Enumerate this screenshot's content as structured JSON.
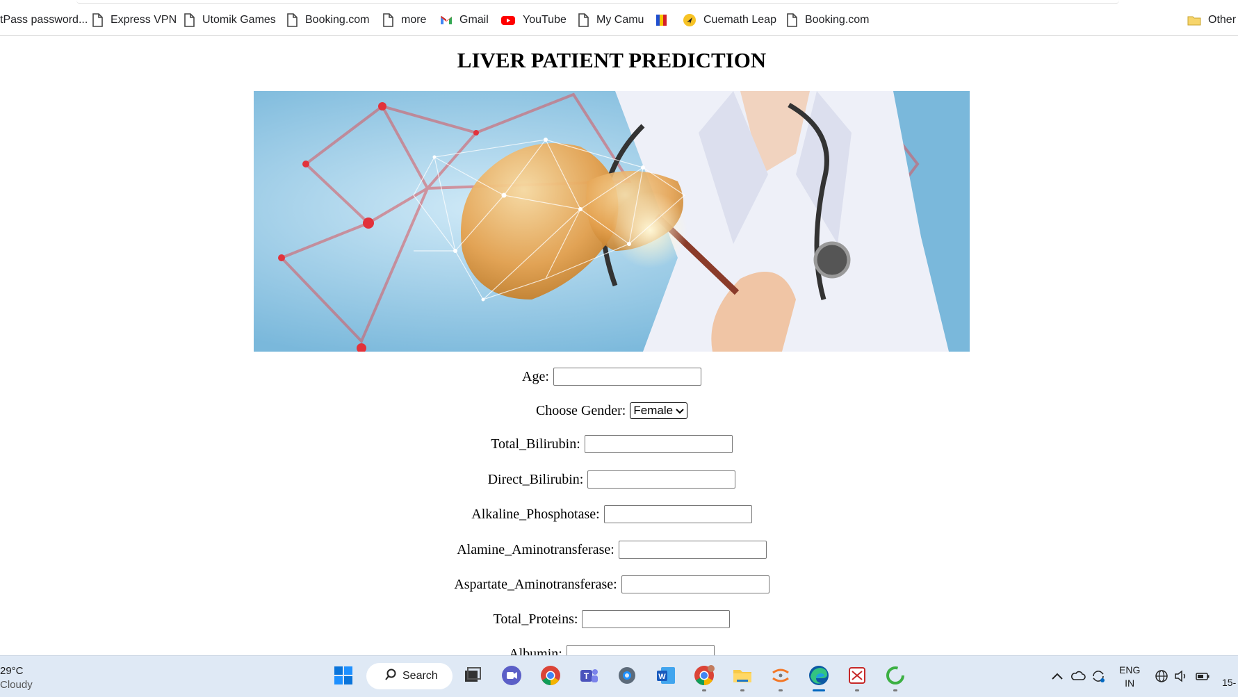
{
  "bookmarks": [
    {
      "label": "tPass password...",
      "icon": "none"
    },
    {
      "label": "Express VPN",
      "icon": "page-icon"
    },
    {
      "label": "Utomik Games",
      "icon": "page-icon"
    },
    {
      "label": "Booking.com",
      "icon": "page-icon"
    },
    {
      "label": "more",
      "icon": "page-icon"
    },
    {
      "label": "Gmail",
      "icon": "gmail-icon"
    },
    {
      "label": "YouTube",
      "icon": "youtube-icon"
    },
    {
      "label": "My Camu",
      "icon": "page-icon"
    },
    {
      "label": "",
      "icon": "flag-icon"
    },
    {
      "label": "Cuemath Leap",
      "icon": "cuemath-icon"
    },
    {
      "label": "Booking.com",
      "icon": "page-icon"
    },
    {
      "label": "Other",
      "icon": "folder-icon"
    }
  ],
  "page": {
    "title": "LIVER PATIENT PREDICTION"
  },
  "form": {
    "age_label": "Age:",
    "age_value": "",
    "gender_label": "Choose Gender:",
    "gender_selected": "Female",
    "total_bilirubin_label": "Total_Bilirubin:",
    "direct_bilirubin_label": "Direct_Bilirubin:",
    "alkaline_phosphotase_label": "Alkaline_Phosphotase:",
    "alamine_aminotransferase_label": "Alamine_Aminotransferase:",
    "aspartate_aminotransferase_label": "Aspartate_Aminotransferase:",
    "total_proteins_label": "Total_Proteins:",
    "albumin_label": "Albumin:"
  },
  "taskbar": {
    "weather_temp": "29°C",
    "weather_desc": "Cloudy",
    "search_label": "Search",
    "lang_line1": "ENG",
    "lang_line2": "IN",
    "time_partial": "15-"
  },
  "colors": {
    "hero_bg": "#7ab8db",
    "liver_orange": "#e4a04d",
    "taskbar_bg": "#dfe9f5",
    "accent": "#0067c0"
  }
}
